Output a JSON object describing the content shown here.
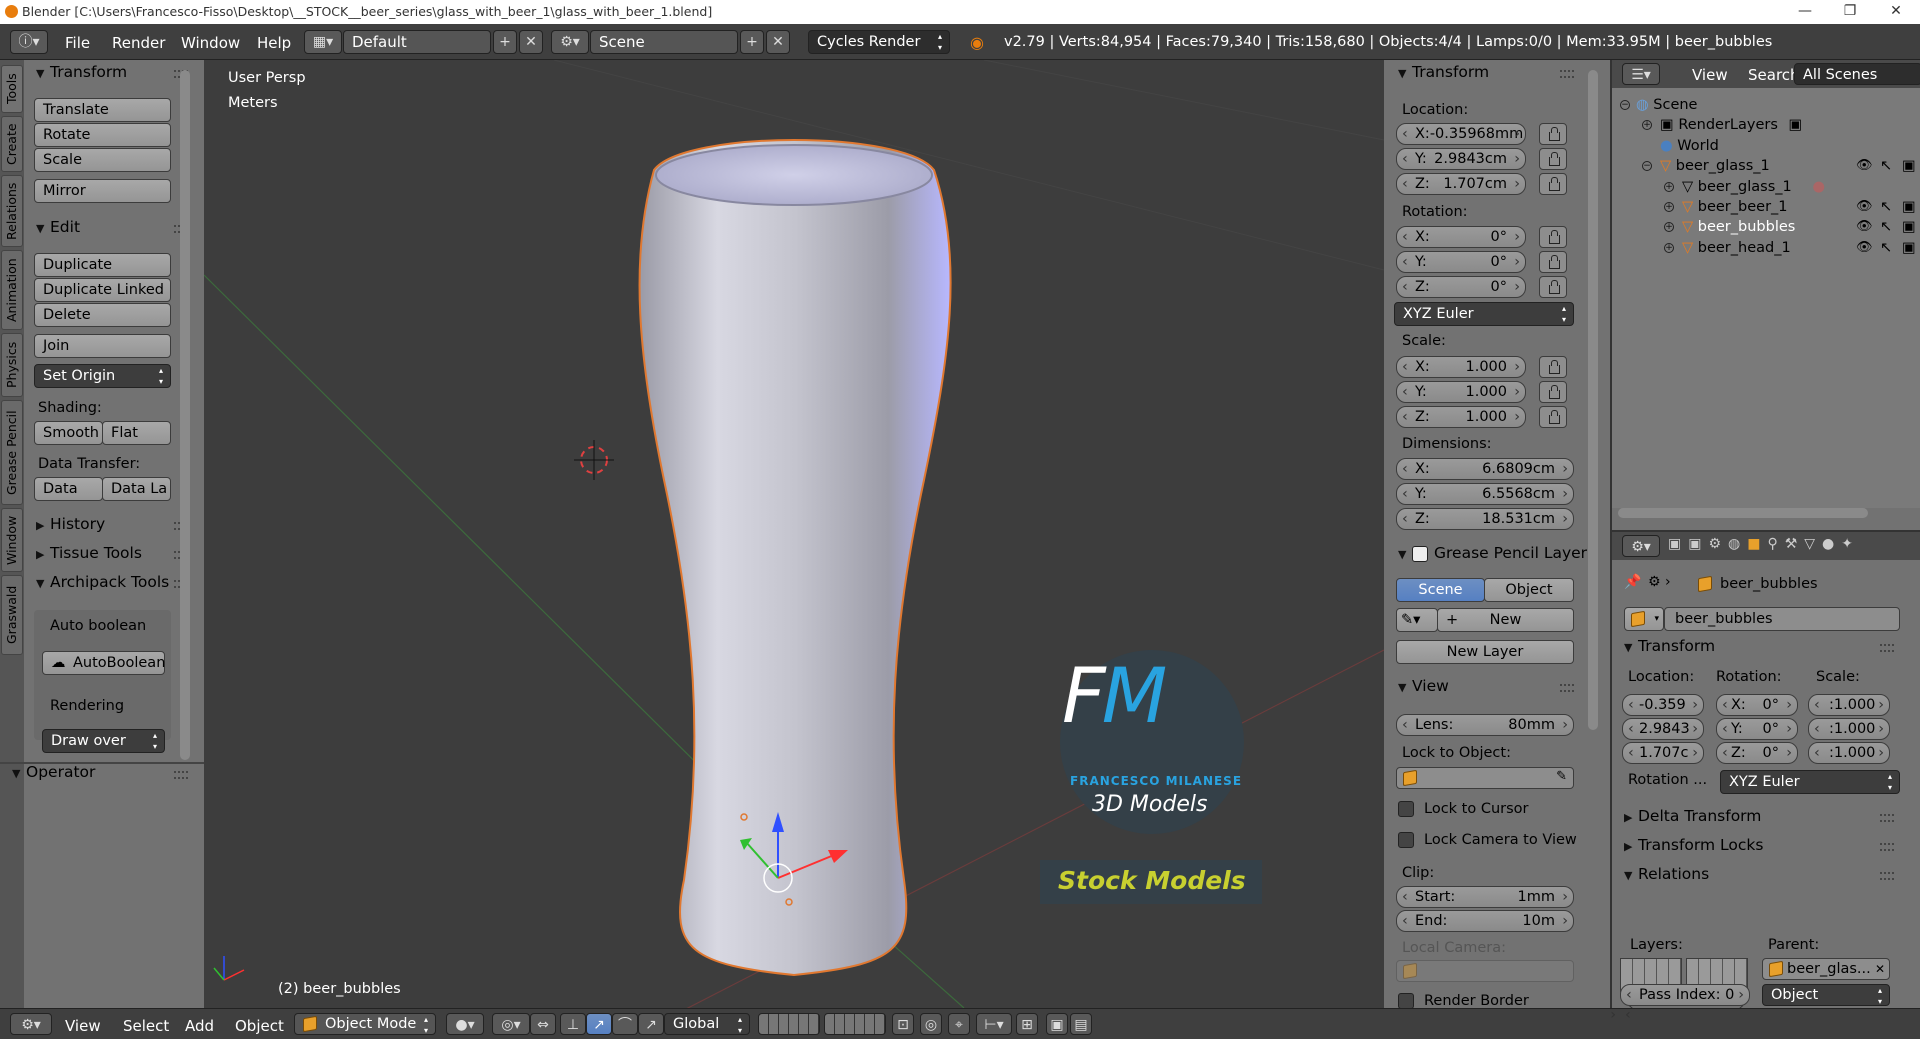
{
  "window": {
    "title": "Blender [C:\\Users\\Francesco-Fisso\\Desktop\\__STOCK__beer_series\\glass_with_beer_1\\glass_with_beer_1.blend]",
    "minimize": "—",
    "maximize": "❐",
    "close": "✕"
  },
  "header": {
    "menus": [
      "File",
      "Render",
      "Window",
      "Help"
    ],
    "layout": "Default",
    "scene": "Scene",
    "engine": "Cycles Render",
    "stats": "v2.79 | Verts:84,954 | Faces:79,340 | Tris:158,680 | Objects:4/4 | Lamps:0/0 | Mem:33.95M | beer_bubbles"
  },
  "tool_tabs": [
    "Tools",
    "Create",
    "Relations",
    "Animation",
    "Physics",
    "Grease Pencil",
    "Window",
    "Graswald"
  ],
  "tools": {
    "transform": {
      "title": "Transform",
      "translate": "Translate",
      "rotate": "Rotate",
      "scale": "Scale",
      "mirror": "Mirror"
    },
    "edit": {
      "title": "Edit",
      "duplicate": "Duplicate",
      "duplicate_linked": "Duplicate Linked",
      "delete": "Delete",
      "join": "Join",
      "set_origin": "Set Origin",
      "shading_label": "Shading:",
      "smooth": "Smooth",
      "flat": "Flat",
      "data_transfer_label": "Data Transfer:",
      "data": "Data",
      "data_la": "Data La"
    },
    "history": "History",
    "tissue": "Tissue Tools",
    "archipack": "Archipack Tools",
    "auto_boolean": "Auto boolean",
    "autoboolean_btn": "AutoBoolean",
    "rendering": "Rendering",
    "draw_over": "Draw over",
    "operator": "Operator"
  },
  "viewport": {
    "persp": "User Persp",
    "units": "Meters",
    "object_label": "(2) beer_bubbles",
    "logo": {
      "letters": "FM",
      "name": "FRANCESCO MILANESE",
      "sub": "3D Models",
      "stock": "Stock Models"
    }
  },
  "properties_n": {
    "transform_title": "Transform",
    "location_label": "Location:",
    "loc": {
      "x": "X:-0.35968mm",
      "y": "Y:",
      "y_val": "2.9843cm",
      "z": "Z:",
      "z_val": "1.707cm"
    },
    "rotation_label": "Rotation:",
    "rot": {
      "x": "X:",
      "x_val": "0°",
      "y": "Y:",
      "y_val": "0°",
      "z": "Z:",
      "z_val": "0°"
    },
    "rot_mode": "XYZ Euler",
    "scale_label": "Scale:",
    "scl": {
      "x": "X:",
      "x_val": "1.000",
      "y": "Y:",
      "y_val": "1.000",
      "z": "Z:",
      "z_val": "1.000"
    },
    "dims_label": "Dimensions:",
    "dim": {
      "x": "X:",
      "x_val": "6.6809cm",
      "y": "Y:",
      "y_val": "6.5568cm",
      "z": "Z:",
      "z_val": "18.531cm"
    },
    "grease_title": "Grease Pencil Layer",
    "gp_scene": "Scene",
    "gp_object": "Object",
    "gp_new": "New",
    "gp_new_layer": "New Layer",
    "view_title": "View",
    "lens_label": "Lens:",
    "lens_val": "80mm",
    "lock_obj_label": "Lock to Object:",
    "lock_cursor": "Lock to Cursor",
    "lock_camera": "Lock Camera to View",
    "clip_label": "Clip:",
    "start_label": "Start:",
    "start_val": "1mm",
    "end_label": "End:",
    "end_val": "10m",
    "local_camera": "Local Camera:",
    "render_border": "Render Border"
  },
  "outliner": {
    "view": "View",
    "search": "Search",
    "all_scenes": "All Scenes",
    "items": [
      "Scene",
      "RenderLayers",
      "World",
      "beer_glass_1",
      "beer_glass_1",
      "beer_beer_1",
      "beer_bubbles",
      "beer_head_1"
    ]
  },
  "object_props": {
    "breadcrumb": "beer_bubbles",
    "name": "beer_bubbles",
    "transform": "Transform",
    "location_label": "Location:",
    "rotation_label": "Rotation:",
    "scale_label": "Scale:",
    "loc": [
      "-0.359",
      "2.9843",
      "1.707c"
    ],
    "rot": [
      "X:",
      "0°",
      "Y:",
      "0°",
      "Z:",
      "0°"
    ],
    "scl": [
      ":1.000",
      ":1.000",
      ":1.000"
    ],
    "rotation_mode_label": "Rotation ...",
    "rotation_mode": "XYZ Euler",
    "delta": "Delta Transform",
    "locks": "Transform Locks",
    "relations": "Relations",
    "layers_label": "Layers:",
    "parent_label": "Parent:",
    "parent": "beer_glas...",
    "parent_type": "Object",
    "pass_index": "Pass Index: 0"
  },
  "footer": {
    "view": "View",
    "select": "Select",
    "add": "Add",
    "object": "Object",
    "mode": "Object Mode",
    "orientation": "Global"
  }
}
